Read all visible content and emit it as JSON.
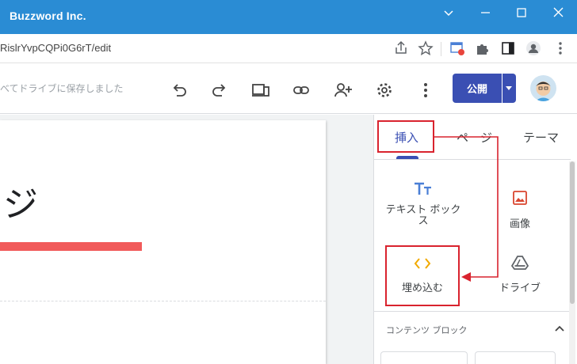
{
  "window": {
    "title": "Buzzword Inc.",
    "controls": [
      {
        "name": "chevron-down-icon"
      },
      {
        "name": "minimize-icon"
      },
      {
        "name": "maximize-icon"
      },
      {
        "name": "close-icon"
      }
    ]
  },
  "address_bar": {
    "url": "RislrYvpCQPi0G6rT/edit",
    "icons": [
      "share-icon",
      "star-icon",
      "extension-badge-icon",
      "puzzle-icon",
      "side-panel-icon",
      "profile-icon",
      "more-vert-icon"
    ]
  },
  "toolbar": {
    "saved_message": "べてドライブに保存しました",
    "icons": [
      "undo-icon",
      "redo-icon",
      "preview-devices-icon",
      "link-icon",
      "share-person-icon",
      "settings-icon",
      "more-vert-icon"
    ],
    "publish_label": "公開"
  },
  "canvas": {
    "page_title": "ジ",
    "accent_color": "#f15a5a"
  },
  "panel": {
    "tabs": [
      {
        "label": "挿入",
        "active": true
      },
      {
        "label": "ペ　ジ",
        "active": false
      },
      {
        "label": "テーマ",
        "active": false
      }
    ],
    "insert_items": [
      {
        "label": "テキスト ボックス",
        "icon": "text-box-icon"
      },
      {
        "label": "画像",
        "icon": "image-icon"
      },
      {
        "label": "埋め込む",
        "icon": "embed-code-icon"
      },
      {
        "label": "ドライブ",
        "icon": "drive-icon"
      }
    ],
    "section": {
      "title": "コンテンツ ブロック",
      "expanded": true
    }
  },
  "annotation": {
    "color": "#d9232e"
  }
}
